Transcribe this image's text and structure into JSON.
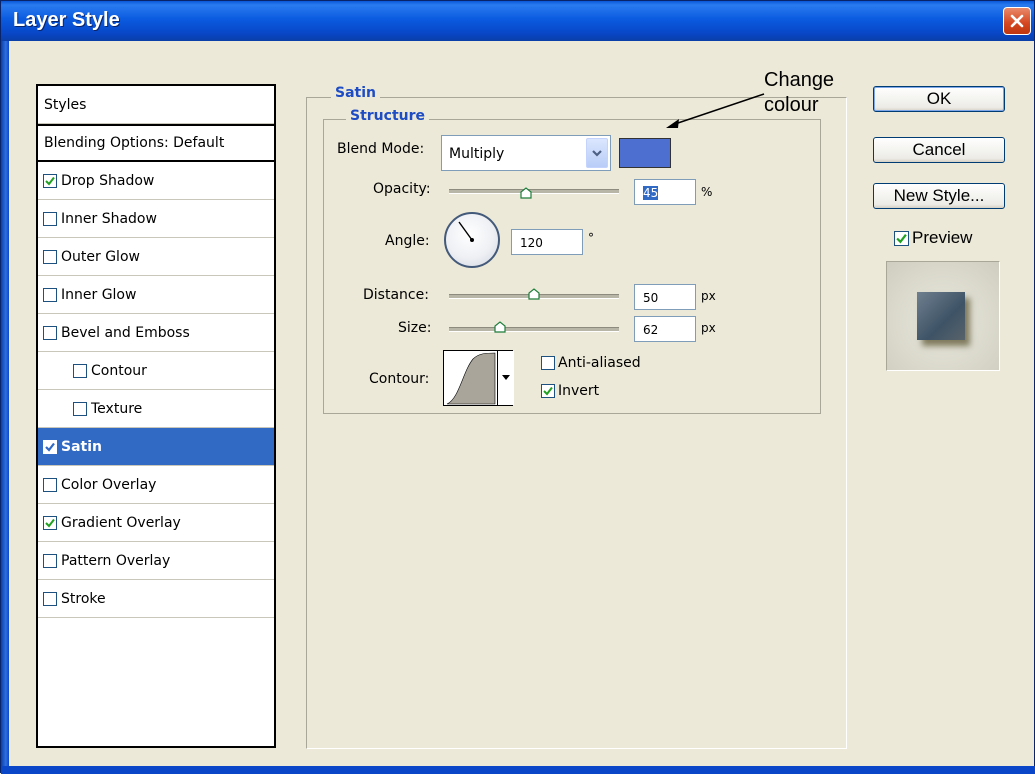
{
  "window": {
    "title": "Layer Style"
  },
  "sidebar": {
    "items": [
      {
        "label": "Styles",
        "checkbox": false,
        "checked": false,
        "indent": 0,
        "selected": false
      },
      {
        "label": "Blending Options: Default",
        "checkbox": false,
        "checked": false,
        "indent": 0,
        "selected": false
      },
      {
        "label": "Drop Shadow",
        "checkbox": true,
        "checked": true,
        "indent": 0,
        "selected": false
      },
      {
        "label": "Inner Shadow",
        "checkbox": true,
        "checked": false,
        "indent": 0,
        "selected": false
      },
      {
        "label": "Outer Glow",
        "checkbox": true,
        "checked": false,
        "indent": 0,
        "selected": false
      },
      {
        "label": "Inner Glow",
        "checkbox": true,
        "checked": false,
        "indent": 0,
        "selected": false
      },
      {
        "label": "Bevel and Emboss",
        "checkbox": true,
        "checked": false,
        "indent": 0,
        "selected": false
      },
      {
        "label": "Contour",
        "checkbox": true,
        "checked": false,
        "indent": 1,
        "selected": false
      },
      {
        "label": "Texture",
        "checkbox": true,
        "checked": false,
        "indent": 1,
        "selected": false
      },
      {
        "label": "Satin",
        "checkbox": true,
        "checked": true,
        "indent": 0,
        "selected": true
      },
      {
        "label": "Color Overlay",
        "checkbox": true,
        "checked": false,
        "indent": 0,
        "selected": false
      },
      {
        "label": "Gradient Overlay",
        "checkbox": true,
        "checked": true,
        "indent": 0,
        "selected": false
      },
      {
        "label": "Pattern Overlay",
        "checkbox": true,
        "checked": false,
        "indent": 0,
        "selected": false
      },
      {
        "label": "Stroke",
        "checkbox": true,
        "checked": false,
        "indent": 0,
        "selected": false
      }
    ]
  },
  "satin": {
    "group_title": "Satin",
    "structure_title": "Structure",
    "blend_mode": {
      "label": "Blend Mode:",
      "value": "Multiply",
      "color": "#4c6fd0"
    },
    "opacity": {
      "label": "Opacity:",
      "value": "45",
      "unit": "%",
      "slider_fraction": 0.45
    },
    "angle": {
      "label": "Angle:",
      "value": "120",
      "unit": "°"
    },
    "distance": {
      "label": "Distance:",
      "value": "50",
      "unit": "px",
      "slider_fraction": 0.5
    },
    "size": {
      "label": "Size:",
      "value": "62",
      "unit": "px",
      "slider_fraction": 0.3
    },
    "contour": {
      "label": "Contour:"
    },
    "anti_aliased": {
      "label": "Anti-aliased",
      "checked": false
    },
    "invert": {
      "label": "Invert",
      "checked": true
    }
  },
  "buttons": {
    "ok": "OK",
    "cancel": "Cancel",
    "new_style": "New Style..."
  },
  "preview": {
    "label": "Preview",
    "checked": true
  },
  "annotation": {
    "line1": "Change",
    "line2": "colour"
  }
}
